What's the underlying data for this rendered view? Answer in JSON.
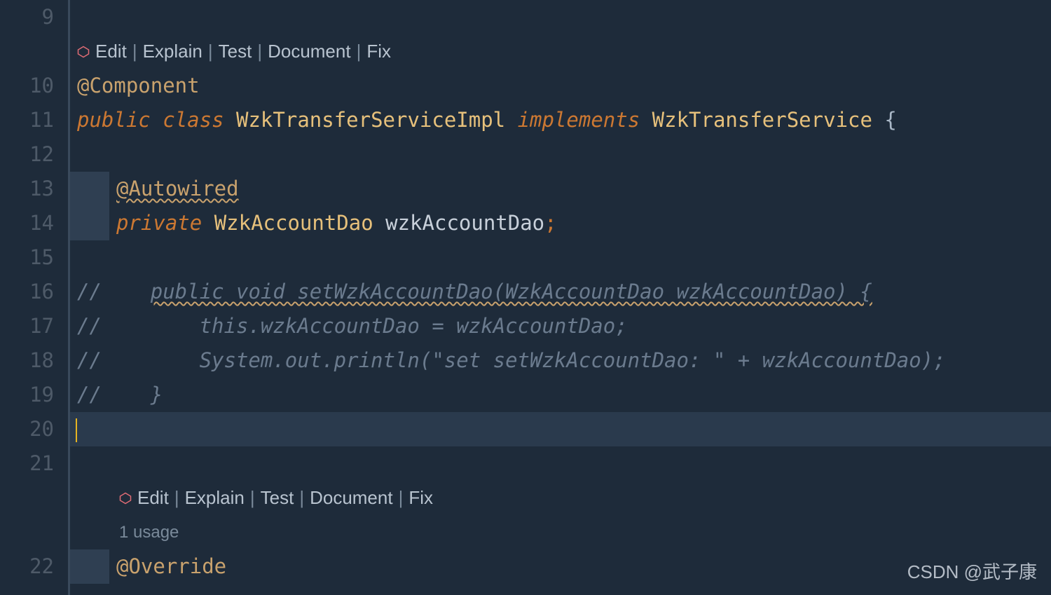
{
  "gutter": {
    "lines": [
      "9",
      "",
      "10",
      "11",
      "12",
      "13",
      "14",
      "15",
      "16",
      "17",
      "18",
      "19",
      "20",
      "21",
      "",
      "",
      "22"
    ]
  },
  "lens": {
    "edit": "Edit",
    "explain": "Explain",
    "test": "Test",
    "document": "Document",
    "fix": "Fix",
    "sep": "|"
  },
  "usage": "1 usage",
  "code": {
    "l10_annotation": "@Component",
    "l11_public": "public",
    "l11_class": "class",
    "l11_classname": "WzkTransferServiceImpl",
    "l11_implements": "implements",
    "l11_iface": "WzkTransferService",
    "l11_brace": "{",
    "l13_annotation": "@Autowired",
    "l14_private": "private",
    "l14_type": "WzkAccountDao",
    "l14_field": "wzkAccountDao",
    "l14_semi": ";",
    "l16_comment_slash": "//",
    "l16_comment_text": "public void setWzkAccountDao(WzkAccountDao wzkAccountDao) {",
    "l17_comment": "//        this.wzkAccountDao = wzkAccountDao;",
    "l18_comment": "//        System.out.println(\"set setWzkAccountDao: \" + wzkAccountDao);",
    "l19_comment": "//    }",
    "l22_annotation": "@Override"
  },
  "watermark": "CSDN @武子康"
}
